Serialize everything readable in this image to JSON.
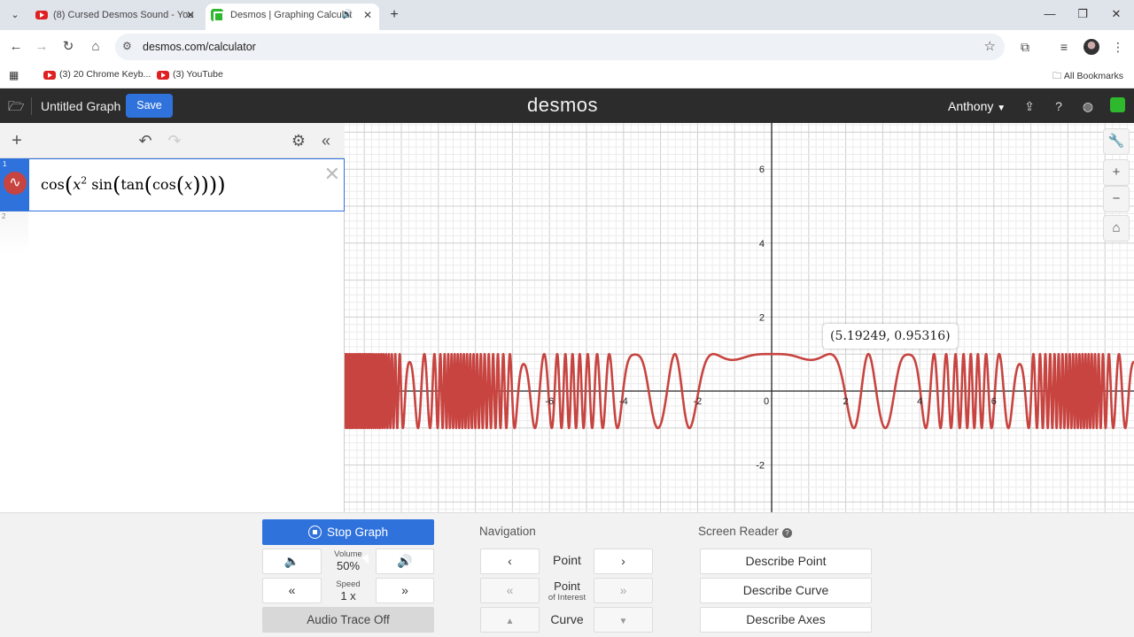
{
  "browser": {
    "tabs": [
      {
        "title": "(8) Cursed Desmos Sound - You",
        "favicon": "youtube-icon"
      },
      {
        "title": "Desmos | Graphing Calculat",
        "favicon": "desmos-icon"
      }
    ],
    "url": "desmos.com/calculator",
    "bookmarks": [
      {
        "label": "(3) 20 Chrome Keyb..."
      },
      {
        "label": "(3) YouTube"
      }
    ],
    "all_bookmarks": "All Bookmarks"
  },
  "desmos": {
    "graph_title": "Untitled Graph",
    "save_label": "Save",
    "logo": "desmos",
    "user": "Anthony",
    "expressions": [
      {
        "index": "1",
        "latex_display": "cos(x² sin(tan(cos(x))))",
        "color": "#c74440"
      },
      {
        "index": "2",
        "latex_display": ""
      }
    ],
    "tooltip": "(5.19249, 0.95316)",
    "axis_labels": {
      "y": [
        "6",
        "4",
        "2",
        "-2"
      ],
      "x": [
        "-6",
        "-4",
        "-2",
        "0",
        "2",
        "4",
        "6"
      ]
    }
  },
  "audio_panel": {
    "stop_graph": "Stop Graph",
    "volume_label": "Volume",
    "volume_value": "50%",
    "speed_label": "Speed",
    "speed_value": "1 x",
    "audio_trace": "Audio Trace Off",
    "navigation_title": "Navigation",
    "nav_point": "Point",
    "nav_point_of_interest": "Point",
    "nav_point_of_interest_sub": "of Interest",
    "nav_curve": "Curve",
    "screen_reader_title": "Screen Reader",
    "describe_point": "Describe Point",
    "describe_curve": "Describe Curve",
    "describe_axes": "Describe Axes"
  }
}
